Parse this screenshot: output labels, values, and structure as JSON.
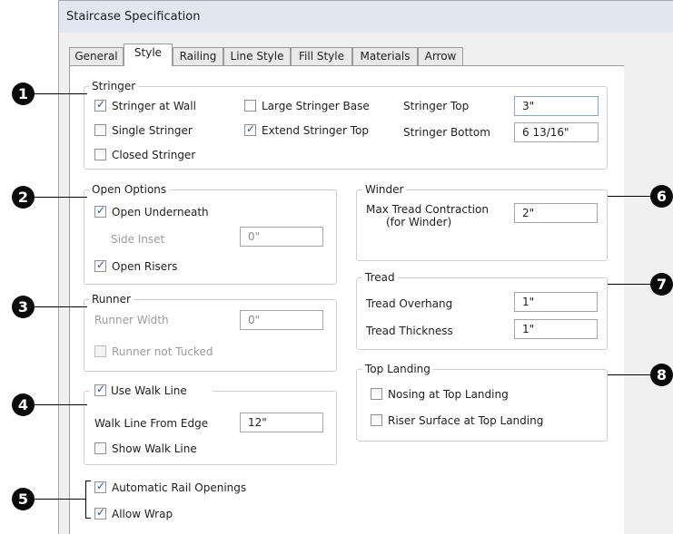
{
  "window": {
    "title": "Staircase Specification"
  },
  "tabs": [
    "General",
    "Style",
    "Railing",
    "Line Style",
    "Fill Style",
    "Materials",
    "Arrow"
  ],
  "stringer": {
    "label": "Stringer",
    "stringer_at_wall": "Stringer at Wall",
    "single_stringer": "Single Stringer",
    "closed_stringer": "Closed Stringer",
    "large_stringer_base": "Large Stringer Base",
    "extend_stringer_top": "Extend Stringer Top",
    "stringer_top_label": "Stringer Top",
    "stringer_top_value": "3\"",
    "stringer_bottom_label": "Stringer Bottom",
    "stringer_bottom_value": "6 13/16\""
  },
  "open_options": {
    "label": "Open Options",
    "open_underneath": "Open Underneath",
    "side_inset_label": "Side Inset",
    "side_inset_value": "0\"",
    "open_risers": "Open Risers"
  },
  "runner": {
    "label": "Runner",
    "runner_width_label": "Runner Width",
    "runner_width_value": "0\"",
    "runner_not_tucked": "Runner not Tucked"
  },
  "walk_line": {
    "use_walk_line": "Use Walk Line",
    "from_edge_label": "Walk Line From Edge",
    "from_edge_value": "12\"",
    "show_walk_line": "Show Walk Line"
  },
  "rail": {
    "automatic_rail_openings": "Automatic Rail Openings",
    "allow_wrap": "Allow Wrap"
  },
  "winder": {
    "label": "Winder",
    "max_contraction_label_1": "Max Tread Contraction",
    "max_contraction_label_2": "(for Winder)",
    "max_contraction_value": "2\""
  },
  "tread": {
    "label": "Tread",
    "overhang_label": "Tread Overhang",
    "overhang_value": "1\"",
    "thickness_label": "Tread Thickness",
    "thickness_value": "1\""
  },
  "top_landing": {
    "label": "Top Landing",
    "nosing": "Nosing at Top Landing",
    "riser_surface": "Riser Surface at Top Landing"
  },
  "callouts": [
    "1",
    "2",
    "3",
    "4",
    "5",
    "6",
    "7",
    "8"
  ]
}
